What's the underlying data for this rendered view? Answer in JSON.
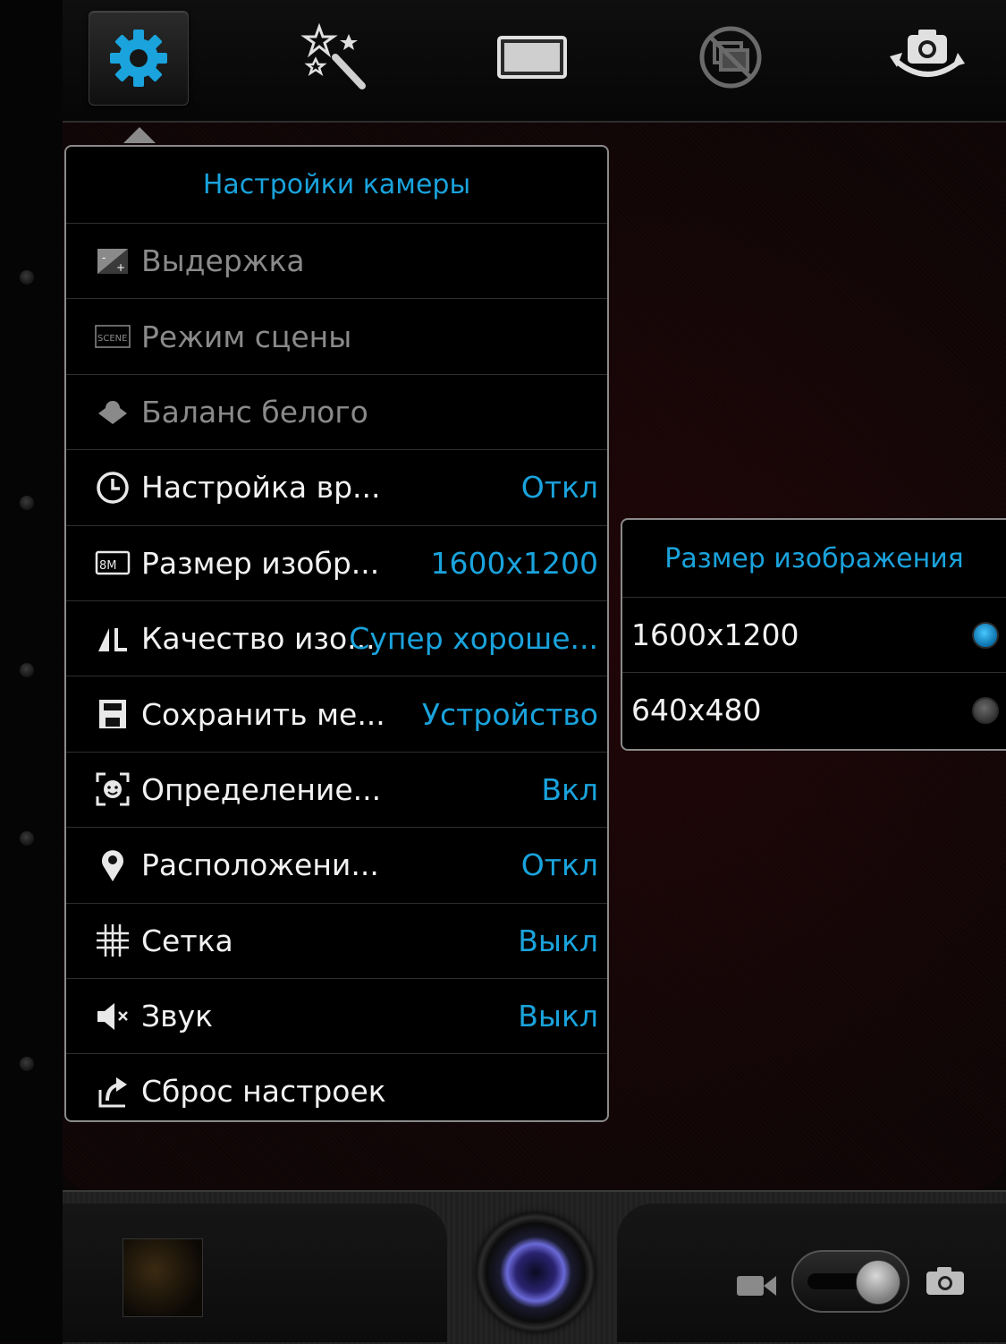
{
  "top_bar": {
    "buttons": [
      {
        "icon": "gear-icon",
        "active": true
      },
      {
        "icon": "magic-wand-icon",
        "active": false
      },
      {
        "icon": "widescreen-icon",
        "active": false
      },
      {
        "icon": "burst-mode-off-icon",
        "active": false
      },
      {
        "icon": "switch-camera-icon",
        "active": false
      }
    ]
  },
  "settings": {
    "title": "Настройки камеры",
    "items": [
      {
        "label": "Выдержка",
        "value": "",
        "icon": "exposure-icon",
        "disabled": true
      },
      {
        "label": "Режим сцены",
        "value": "",
        "icon": "scene-icon",
        "disabled": true
      },
      {
        "label": "Баланс белого",
        "value": "",
        "icon": "white-balance-icon",
        "disabled": true
      },
      {
        "label": "Настройка вр...",
        "value": "Откл",
        "icon": "timer-icon",
        "disabled": false
      },
      {
        "label": "Размер изобр...",
        "value": "1600x1200",
        "icon": "picture-size-icon",
        "disabled": false
      },
      {
        "label": "Качество изо...",
        "value": "Супер хороше...",
        "icon": "picture-quality-icon",
        "disabled": false
      },
      {
        "label": "Сохранить ме...",
        "value": "Устройство",
        "icon": "storage-icon",
        "disabled": false
      },
      {
        "label": "Определение...",
        "value": "Вкл",
        "icon": "face-detection-icon",
        "disabled": false
      },
      {
        "label": "Расположени...",
        "value": "Откл",
        "icon": "location-icon",
        "disabled": false
      },
      {
        "label": "Сетка",
        "value": "Выкл",
        "icon": "grid-icon",
        "disabled": false
      },
      {
        "label": "Звук",
        "value": "Выкл",
        "icon": "sound-off-icon",
        "disabled": false
      },
      {
        "label": "Сброс настроек",
        "value": "",
        "icon": "reset-icon",
        "disabled": false
      }
    ]
  },
  "image_size_menu": {
    "title": "Размер изображения",
    "options": [
      {
        "label": "1600x1200",
        "selected": true
      },
      {
        "label": "640x480",
        "selected": false
      }
    ]
  },
  "colors": {
    "accent": "#1aa3dc",
    "text": "#f2f2f2",
    "disabled_text": "#8a8a8a"
  }
}
